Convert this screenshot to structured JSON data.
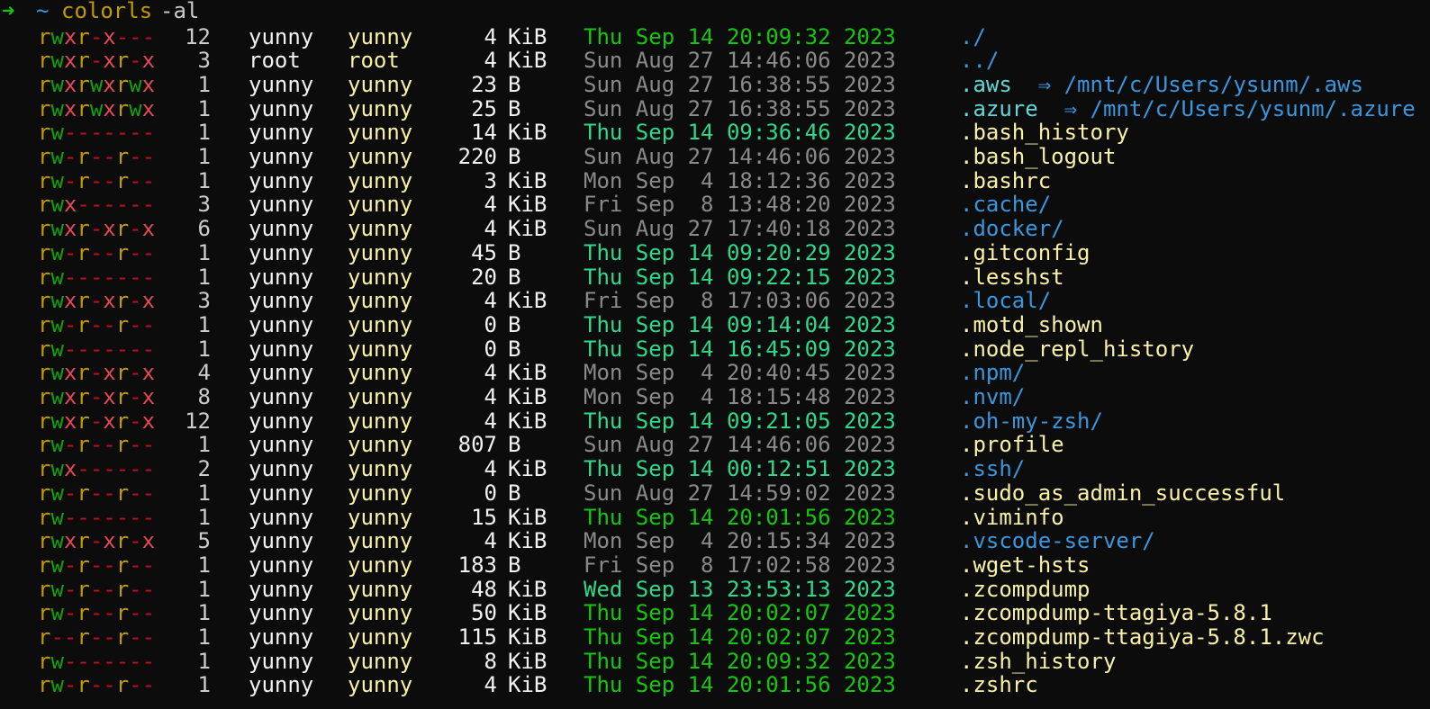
{
  "prompt": {
    "arrow": "➜",
    "cwd": "~",
    "command": "colorls",
    "args": "-al"
  },
  "colors": {
    "background": "#0c0c0c",
    "perm_read": "#c19c00",
    "perm_write": "#13a10e",
    "perm_exec": "#e74856",
    "perm_none": "#c50f1f",
    "owner": "#f2f2f2",
    "group": "#f9f1a5",
    "date_recent": "#16c60c",
    "date_day": "#2fd98c",
    "date_old": "#8a8a8a",
    "dir": "#3a96dd",
    "file": "#f9f1a5"
  },
  "entries": [
    {
      "perm": "rwxr-x---",
      "links": "12",
      "owner": "yunny",
      "group": "yunny",
      "size": "4",
      "unit": "KiB",
      "date": "Thu Sep 14 20:09:32 2023",
      "age": "recent",
      "name": "./",
      "kind": "dir"
    },
    {
      "perm": "rwxr-xr-x",
      "links": "3",
      "owner": "root",
      "group": "root",
      "size": "4",
      "unit": "KiB",
      "date": "Sun Aug 27 14:46:06 2023",
      "age": "old",
      "name": "../",
      "kind": "dir"
    },
    {
      "perm": "rwxrwxrwx",
      "links": "1",
      "owner": "yunny",
      "group": "yunny",
      "size": "23",
      "unit": "B",
      "date": "Sun Aug 27 16:38:55 2023",
      "age": "old",
      "name": ".aws",
      "kind": "link",
      "target": "⇒ /mnt/c/Users/ysunm/.aws"
    },
    {
      "perm": "rwxrwxrwx",
      "links": "1",
      "owner": "yunny",
      "group": "yunny",
      "size": "25",
      "unit": "B",
      "date": "Sun Aug 27 16:38:55 2023",
      "age": "old",
      "name": ".azure",
      "kind": "link",
      "target": "⇒ /mnt/c/Users/ysunm/.azure"
    },
    {
      "perm": "rw-------",
      "links": "1",
      "owner": "yunny",
      "group": "yunny",
      "size": "14",
      "unit": "KiB",
      "date": "Thu Sep 14 09:36:46 2023",
      "age": "day",
      "name": ".bash_history",
      "kind": "file"
    },
    {
      "perm": "rw-r--r--",
      "links": "1",
      "owner": "yunny",
      "group": "yunny",
      "size": "220",
      "unit": "B",
      "date": "Sun Aug 27 14:46:06 2023",
      "age": "old",
      "name": ".bash_logout",
      "kind": "file"
    },
    {
      "perm": "rw-r--r--",
      "links": "1",
      "owner": "yunny",
      "group": "yunny",
      "size": "3",
      "unit": "KiB",
      "date": "Mon Sep  4 18:12:36 2023",
      "age": "old",
      "name": ".bashrc",
      "kind": "file"
    },
    {
      "perm": "rwx------",
      "links": "3",
      "owner": "yunny",
      "group": "yunny",
      "size": "4",
      "unit": "KiB",
      "date": "Fri Sep  8 13:48:20 2023",
      "age": "old",
      "name": ".cache/",
      "kind": "dir"
    },
    {
      "perm": "rwxr-xr-x",
      "links": "6",
      "owner": "yunny",
      "group": "yunny",
      "size": "4",
      "unit": "KiB",
      "date": "Sun Aug 27 17:40:18 2023",
      "age": "old",
      "name": ".docker/",
      "kind": "dir"
    },
    {
      "perm": "rw-r--r--",
      "links": "1",
      "owner": "yunny",
      "group": "yunny",
      "size": "45",
      "unit": "B",
      "date": "Thu Sep 14 09:20:29 2023",
      "age": "day",
      "name": ".gitconfig",
      "kind": "file"
    },
    {
      "perm": "rw-------",
      "links": "1",
      "owner": "yunny",
      "group": "yunny",
      "size": "20",
      "unit": "B",
      "date": "Thu Sep 14 09:22:15 2023",
      "age": "day",
      "name": ".lesshst",
      "kind": "file"
    },
    {
      "perm": "rwxr-xr-x",
      "links": "3",
      "owner": "yunny",
      "group": "yunny",
      "size": "4",
      "unit": "KiB",
      "date": "Fri Sep  8 17:03:06 2023",
      "age": "old",
      "name": ".local/",
      "kind": "dir"
    },
    {
      "perm": "rw-r--r--",
      "links": "1",
      "owner": "yunny",
      "group": "yunny",
      "size": "0",
      "unit": "B",
      "date": "Thu Sep 14 09:14:04 2023",
      "age": "day",
      "name": ".motd_shown",
      "kind": "file"
    },
    {
      "perm": "rw-------",
      "links": "1",
      "owner": "yunny",
      "group": "yunny",
      "size": "0",
      "unit": "B",
      "date": "Thu Sep 14 16:45:09 2023",
      "age": "day",
      "name": ".node_repl_history",
      "kind": "file"
    },
    {
      "perm": "rwxr-xr-x",
      "links": "4",
      "owner": "yunny",
      "group": "yunny",
      "size": "4",
      "unit": "KiB",
      "date": "Mon Sep  4 20:40:45 2023",
      "age": "old",
      "name": ".npm/",
      "kind": "dir"
    },
    {
      "perm": "rwxr-xr-x",
      "links": "8",
      "owner": "yunny",
      "group": "yunny",
      "size": "4",
      "unit": "KiB",
      "date": "Mon Sep  4 18:15:48 2023",
      "age": "old",
      "name": ".nvm/",
      "kind": "dir"
    },
    {
      "perm": "rwxr-xr-x",
      "links": "12",
      "owner": "yunny",
      "group": "yunny",
      "size": "4",
      "unit": "KiB",
      "date": "Thu Sep 14 09:21:05 2023",
      "age": "day",
      "name": ".oh-my-zsh/",
      "kind": "dir"
    },
    {
      "perm": "rw-r--r--",
      "links": "1",
      "owner": "yunny",
      "group": "yunny",
      "size": "807",
      "unit": "B",
      "date": "Sun Aug 27 14:46:06 2023",
      "age": "old",
      "name": ".profile",
      "kind": "file"
    },
    {
      "perm": "rwx------",
      "links": "2",
      "owner": "yunny",
      "group": "yunny",
      "size": "4",
      "unit": "KiB",
      "date": "Thu Sep 14 00:12:51 2023",
      "age": "day",
      "name": ".ssh/",
      "kind": "dir"
    },
    {
      "perm": "rw-r--r--",
      "links": "1",
      "owner": "yunny",
      "group": "yunny",
      "size": "0",
      "unit": "B",
      "date": "Sun Aug 27 14:59:02 2023",
      "age": "old",
      "name": ".sudo_as_admin_successful",
      "kind": "file"
    },
    {
      "perm": "rw-------",
      "links": "1",
      "owner": "yunny",
      "group": "yunny",
      "size": "15",
      "unit": "KiB",
      "date": "Thu Sep 14 20:01:56 2023",
      "age": "recent",
      "name": ".viminfo",
      "kind": "file"
    },
    {
      "perm": "rwxr-xr-x",
      "links": "5",
      "owner": "yunny",
      "group": "yunny",
      "size": "4",
      "unit": "KiB",
      "date": "Mon Sep  4 20:15:34 2023",
      "age": "old",
      "name": ".vscode-server/",
      "kind": "dir"
    },
    {
      "perm": "rw-r--r--",
      "links": "1",
      "owner": "yunny",
      "group": "yunny",
      "size": "183",
      "unit": "B",
      "date": "Fri Sep  8 17:02:58 2023",
      "age": "old",
      "name": ".wget-hsts",
      "kind": "file"
    },
    {
      "perm": "rw-r--r--",
      "links": "1",
      "owner": "yunny",
      "group": "yunny",
      "size": "48",
      "unit": "KiB",
      "date": "Wed Sep 13 23:53:13 2023",
      "age": "day",
      "name": ".zcompdump",
      "kind": "file"
    },
    {
      "perm": "rw-r--r--",
      "links": "1",
      "owner": "yunny",
      "group": "yunny",
      "size": "50",
      "unit": "KiB",
      "date": "Thu Sep 14 20:02:07 2023",
      "age": "recent",
      "name": ".zcompdump-ttagiya-5.8.1",
      "kind": "file"
    },
    {
      "perm": "r--r--r--",
      "links": "1",
      "owner": "yunny",
      "group": "yunny",
      "size": "115",
      "unit": "KiB",
      "date": "Thu Sep 14 20:02:07 2023",
      "age": "recent",
      "name": ".zcompdump-ttagiya-5.8.1.zwc",
      "kind": "file"
    },
    {
      "perm": "rw-------",
      "links": "1",
      "owner": "yunny",
      "group": "yunny",
      "size": "8",
      "unit": "KiB",
      "date": "Thu Sep 14 20:09:32 2023",
      "age": "recent",
      "name": ".zsh_history",
      "kind": "file"
    },
    {
      "perm": "rw-r--r--",
      "links": "1",
      "owner": "yunny",
      "group": "yunny",
      "size": "4",
      "unit": "KiB",
      "date": "Thu Sep 14 20:01:56 2023",
      "age": "recent",
      "name": ".zshrc",
      "kind": "file"
    }
  ]
}
